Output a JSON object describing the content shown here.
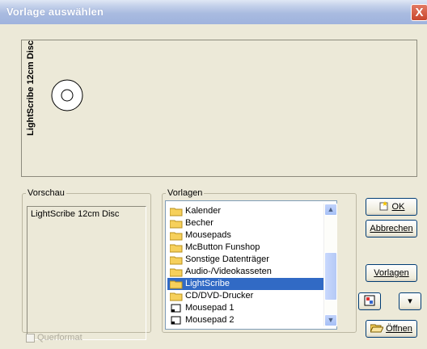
{
  "window": {
    "title": "Vorlage auswählen",
    "close_label": "X"
  },
  "preview": {
    "vertical_label": "LightScribe 12cm Disc"
  },
  "vorschau": {
    "legend": "Vorschau",
    "text": "LightScribe 12cm Disc",
    "querformat_label": "Querformat"
  },
  "vorlagen": {
    "legend": "Vorlagen",
    "items": [
      {
        "label": "Kalender",
        "icon": "folder-icon"
      },
      {
        "label": "Becher",
        "icon": "folder-icon"
      },
      {
        "label": "Mousepads",
        "icon": "folder-icon"
      },
      {
        "label": "McButton Funshop",
        "icon": "folder-icon"
      },
      {
        "label": "Sonstige Datenträger",
        "icon": "folder-icon"
      },
      {
        "label": "Audio-/Videokasseten",
        "icon": "folder-icon"
      },
      {
        "label": "LightScribe",
        "icon": "folder-icon",
        "selected": true
      },
      {
        "label": "CD/DVD-Drucker",
        "icon": "folder-icon"
      },
      {
        "label": "Mousepad 1",
        "icon": "template-icon"
      },
      {
        "label": "Mousepad 2",
        "icon": "template-icon"
      }
    ]
  },
  "buttons": {
    "ok": "OK",
    "abbrechen": "Abbrechen",
    "vorlagen": "Vorlagen",
    "oeffnen": "Öffnen"
  },
  "colors": {
    "selection": "#316ac5",
    "window_bg": "#ece9d8",
    "title_bar": "#a9bbe0"
  }
}
